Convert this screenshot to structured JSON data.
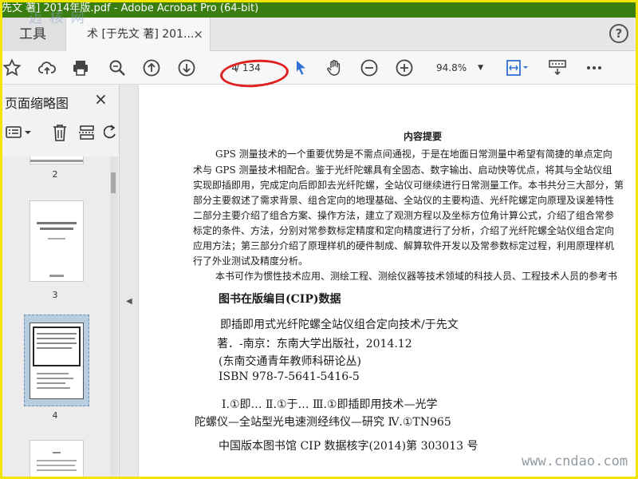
{
  "titlebar": {
    "title": "先文 著] 2014年版.pdf - Adobe Acrobat Pro (64-bit)"
  },
  "watermark_logo": "迈 核 网",
  "tabs": {
    "tools_label": "工具",
    "doc_label": "术 [于先文 著] 201...",
    "close": "×",
    "help": "?"
  },
  "toolbar": {
    "page_current": "4",
    "page_total": "/ 134",
    "zoom": "94.8%",
    "icons": [
      "star-icon",
      "upload-cloud-icon",
      "print-icon",
      "zoom-search-icon",
      "page-up-icon",
      "page-down-icon",
      "select-cursor-icon",
      "hand-tool-icon",
      "zoom-out-icon",
      "zoom-in-icon",
      "fit-page-icon",
      "comment-tool-icon",
      "more-icon"
    ],
    "accent_color": "#2f6fd6"
  },
  "thumb_panel": {
    "title": "页面缩略图",
    "close": "×",
    "pages": [
      {
        "num": "2"
      },
      {
        "num": "3"
      },
      {
        "num": "4"
      }
    ],
    "selected": "4"
  },
  "document": {
    "summary_title": "内容提要",
    "paragraph": [
      "GPS 测量技术的一个重要优势是不需点间通视，于是在地面日常测量中希望有简捷的单点定向",
      "术与 GPS 测量技术相配合。鉴于光纤陀螺具有全固态、数字输出、启动快等优点，将其与全站仪组",
      "实现即插即用，完成定向后即卸去光纤陀螺，全站仪可继续进行日常测量工作。本书共分三大部分，第",
      "部分主要叙述了需求背景、组合定向的地理基础、全站仪的主要构造、光纤陀螺定向原理及误差特性",
      "二部分主要介绍了组合方案、操作方法，建立了观测方程以及坐标方位角计算公式，介绍了组合常参",
      "标定的条件、方法，分别对常参数标定精度和定向精度进行了分析，介绍了光纤陀螺全站仪组合定向",
      "应用方法；第三部分介绍了原理样机的硬件制成、解算软件开发以及常参数标定过程，利用原理样机",
      "行了外业测试及精度分析。",
      "本书可作为惯性技术应用、测绘工程、测绘仪器等技术领域的科技人员、工程技术人员的参考书"
    ],
    "cip_heading": "图书在版编目(CIP)数据",
    "cip_lines": [
      "即插即用式光纤陀螺全站仪组合定向技术/于先文",
      "著．-南京：东南大学出版社，2014.12",
      "(东南交通青年教师科研论丛)",
      "ISBN  978-7-5641-5416-5",
      "Ⅰ.①即…  Ⅱ.①于…  Ⅲ.①即插即用技术—光学",
      "陀螺仪—全站型光电速测经纬仪—研究  Ⅳ.①TN965",
      "中国版本图书馆 CIP 数据核字(2014)第 303013 号"
    ]
  },
  "watermark_url": "www.cndao.com"
}
